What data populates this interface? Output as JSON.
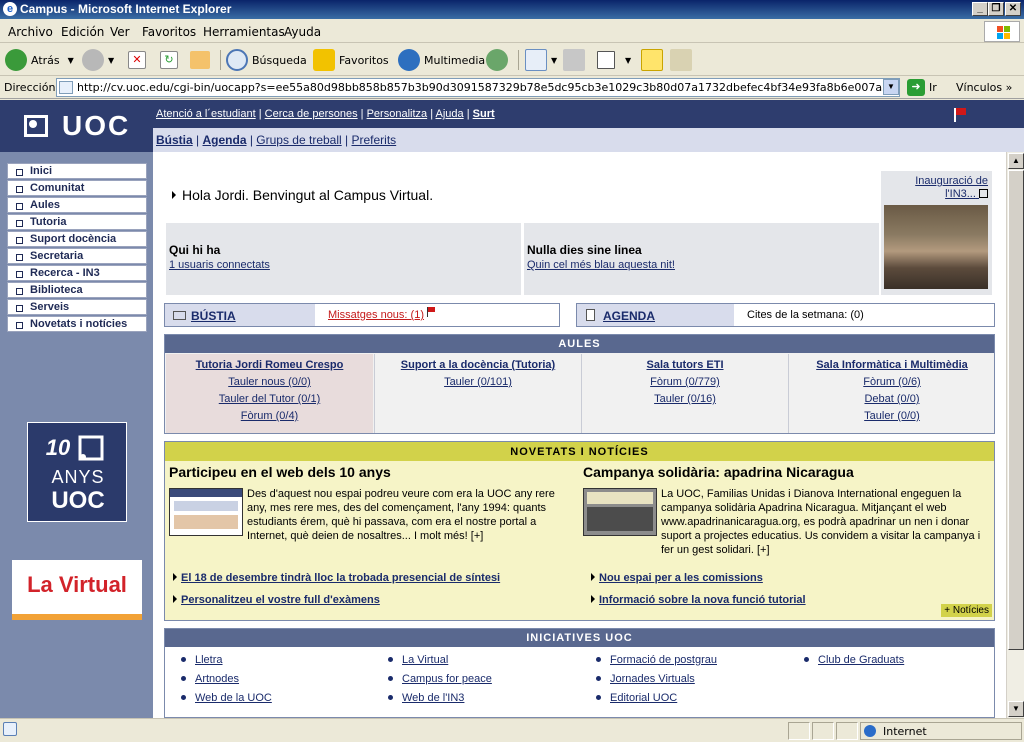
{
  "window": {
    "title": "Campus - Microsoft Internet Explorer"
  },
  "menu": [
    "Archivo",
    "Edición",
    "Ver",
    "Favoritos",
    "Herramientas",
    "Ayuda"
  ],
  "toolbar": {
    "back": "Atrás",
    "search": "Búsqueda",
    "favorites": "Favoritos",
    "media": "Multimedia"
  },
  "address": {
    "label": "Dirección",
    "url": "http://cv.uoc.edu/cgi-bin/uocapp?s=ee55a80d98bb858b857b3b90d3091587329b78e5dc95cb3e1029c3b80d07a1732dbefec4bf34e93fa8b6e007a3c5521e42aff06a3b8",
    "go": "Ir",
    "links": "Vínculos"
  },
  "logo": "UOC",
  "topnav": {
    "row1": [
      "Atenció a l´estudiant",
      "Cerca de persones",
      "Personalitza",
      "Ajuda"
    ],
    "logout": "Surt",
    "row2": [
      "Bústia",
      "Agenda",
      "Grups de treball",
      "Preferits"
    ]
  },
  "sidebar": {
    "items": [
      "Inici",
      "Comunitat",
      "Aules",
      "Tutoria",
      "Suport docència",
      "Secretaria",
      "Recerca - IN3",
      "Biblioteca",
      "Serveis",
      "Novetats i notícies"
    ]
  },
  "anys": {
    "number": "10",
    "word": "ANYS",
    "brand": "UOC"
  },
  "lavirtual": "La Virtual",
  "welcome": {
    "greeting": "Hola Jordi. Benvingut al Campus Virtual.",
    "who_title": "Qui hi ha",
    "who_link": "1 usuaris connectats",
    "motto_title": "Nulla dies sine linea",
    "motto_link": "Quin cel més blau aquesta nit!",
    "inaug_caption": "Inauguració de l'IN3..."
  },
  "bustia": {
    "label": "BÚSTIA",
    "msg": "Missatges nous: (1)"
  },
  "agenda": {
    "label": "AGENDA",
    "msg": "Cites de la setmana: (0)"
  },
  "aules": {
    "title": "AULES",
    "columns": [
      {
        "title": "Tutoria Jordi Romeu Crespo",
        "items": [
          "Tauler nous (0/0)",
          "Tauler del Tutor (0/1)",
          "Fòrum (0/4)"
        ]
      },
      {
        "title": "Suport a la docència (Tutoria)",
        "items": [
          "Tauler (0/101)"
        ]
      },
      {
        "title": "Sala tutors ETI",
        "items": [
          "Fòrum (0/779)",
          "Tauler (0/16)"
        ]
      },
      {
        "title": "Sala Informàtica i Multimèdia",
        "items": [
          "Fòrum (0/6)",
          "Debat (0/0)",
          "Tauler (0/0)"
        ]
      }
    ]
  },
  "novetats": {
    "title": "NOVETATS I NOTÍCIES",
    "news": [
      {
        "title": "Participeu en el web dels 10 anys",
        "text": "Des d'aquest nou espai podreu veure com era la UOC any rere any, mes rere mes, des del començament, l'any 1994: quants estudiants érem, què hi passava, com era el nostre portal a Internet, què deien de nosaltres... I molt més! [+]"
      },
      {
        "title": "Campanya solidària: apadrina Nicaragua",
        "text": "La UOC, Familias Unidas i Dianova International engeguen la campanya solidària Apadrina Nicaragua. Mitjançant el web www.apadrinanicaragua.org, es podrà apadrinar un nen i donar suport a projectes educatius. Us convidem a visitar la campanya i fer un gest solidari. [+]"
      }
    ],
    "links": [
      "El 18 de desembre tindrà lloc la trobada presencial de síntesi",
      "Nou espai per a les comissions",
      "Personalitzeu el vostre full d'exàmens",
      "Informació sobre la nova funció tutorial"
    ],
    "more": "+ Notícies"
  },
  "iniciatives": {
    "title": "INICIATIVES UOC",
    "cols": [
      [
        "Lletra",
        "Artnodes",
        "Web de la UOC"
      ],
      [
        "La Virtual",
        "Campus for peace",
        "Web de l'IN3"
      ],
      [
        "Formació de postgrau",
        "Jornades Virtuals",
        "Editorial UOC"
      ],
      [
        "Club de Graduats"
      ]
    ]
  },
  "status": {
    "zone": "Internet"
  }
}
